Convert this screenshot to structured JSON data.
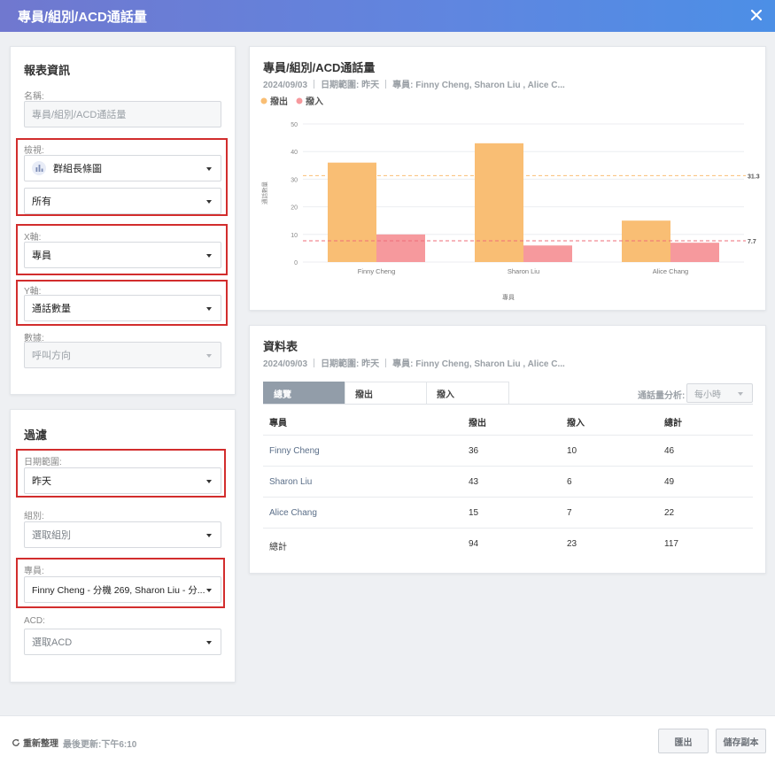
{
  "window": {
    "title": "專員/組別/ACD通話量"
  },
  "report_info": {
    "title": "報表資訊",
    "name_label": "名稱:",
    "name_value": "專員/組別/ACD通話量",
    "view_label": "檢視:",
    "view_value": "群組長條圖",
    "view_scope": "所有",
    "x_label": "X軸:",
    "x_value": "專員",
    "y_label": "Y軸:",
    "y_value": "通話數量",
    "data_label": "數據:",
    "data_value": "呼叫方向"
  },
  "filter": {
    "title": "過濾",
    "date_label": "日期範圍:",
    "date_value": "昨天",
    "group_label": "組別:",
    "group_value": "選取組別",
    "agent_label": "專員:",
    "agent_value": "Finny Cheng - 分機 269, Sharon Liu  - 分...",
    "acd_label": "ACD:",
    "acd_value": "選取ACD"
  },
  "chart_panel": {
    "title": "專員/組別/ACD通話量",
    "date": "2024/09/03",
    "range": "日期範圍: 昨天",
    "agents": "專員: Finny Cheng, Sharon Liu , Alice C..."
  },
  "chart_data": {
    "type": "bar",
    "categories": [
      "Finny Cheng",
      "Sharon Liu",
      "Alice Chang"
    ],
    "series": [
      {
        "name": "撥出",
        "values": [
          36,
          43,
          15
        ],
        "color": "#f9be74"
      },
      {
        "name": "撥入",
        "values": [
          10,
          6,
          7
        ],
        "color": "#f6999d"
      }
    ],
    "xlabel": "專員",
    "ylabel": "通話數量",
    "ylim": [
      0,
      50
    ],
    "yticks": [
      0,
      10,
      20,
      30,
      40,
      50
    ],
    "reference_lines": [
      {
        "value": 31.3,
        "label": "31.3",
        "color": "#f9be74"
      },
      {
        "value": 7.7,
        "label": "7.7",
        "color": "#ee6d79"
      }
    ],
    "legend_position": "top-left",
    "grid": true
  },
  "table_panel": {
    "title": "資料表",
    "date": "2024/09/03",
    "range": "日期範圍: 昨天",
    "agents": "專員: Finny Cheng, Sharon Liu , Alice C...",
    "tabs": [
      "總覽",
      "撥出",
      "撥入"
    ],
    "analysis_label": "通話量分析:",
    "analysis_value": "每小時",
    "headers": [
      "專員",
      "撥出",
      "撥入",
      "總計"
    ],
    "rows": [
      [
        "Finny Cheng",
        "36",
        "10",
        "46"
      ],
      [
        "Sharon Liu",
        "43",
        "6",
        "49"
      ],
      [
        "Alice Chang",
        "15",
        "7",
        "22"
      ],
      [
        "總計",
        "94",
        "23",
        "117"
      ]
    ]
  },
  "footer": {
    "refresh": "重新整理",
    "last_update": "最後更新:下午6:10",
    "export": "匯出",
    "save_copy": "儲存副本"
  }
}
